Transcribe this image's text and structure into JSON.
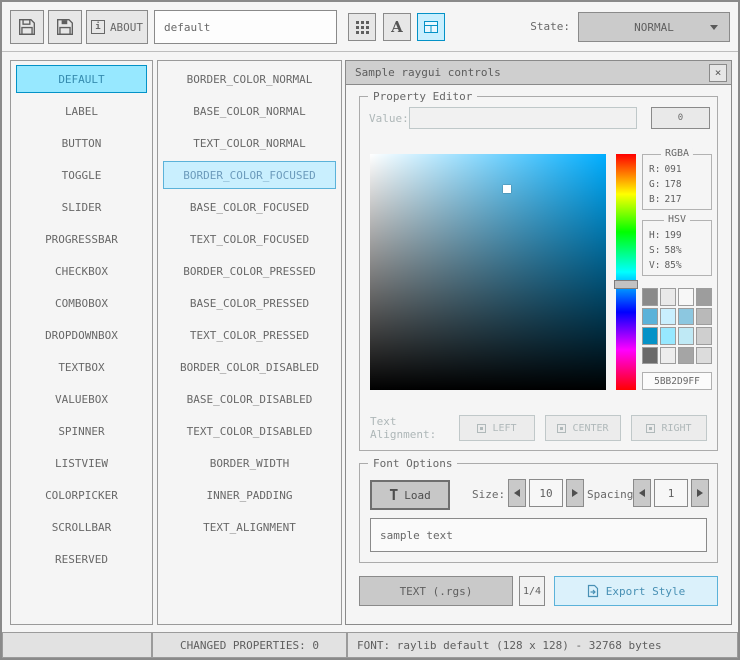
{
  "toolbar": {
    "about_label": "ABOUT",
    "style_name": "default",
    "state_label": "State:",
    "state_value": "NORMAL"
  },
  "icons": {
    "info": "i",
    "letter_a": "A",
    "font_load": "T",
    "close": "×"
  },
  "colors": {
    "accent_focused": "#5bb2d9",
    "accent_pressed": "#0492c7",
    "selected_color": "#5BB2D9"
  },
  "controls_list": {
    "selected_index": 0,
    "items": [
      "DEFAULT",
      "LABEL",
      "BUTTON",
      "TOGGLE",
      "SLIDER",
      "PROGRESSBAR",
      "CHECKBOX",
      "COMBOBOX",
      "DROPDOWNBOX",
      "TEXTBOX",
      "VALUEBOX",
      "SPINNER",
      "LISTVIEW",
      "COLORPICKER",
      "SCROLLBAR",
      "RESERVED"
    ]
  },
  "properties_list": {
    "selected_index": 3,
    "items": [
      "BORDER_COLOR_NORMAL",
      "BASE_COLOR_NORMAL",
      "TEXT_COLOR_NORMAL",
      "BORDER_COLOR_FOCUSED",
      "BASE_COLOR_FOCUSED",
      "TEXT_COLOR_FOCUSED",
      "BORDER_COLOR_PRESSED",
      "BASE_COLOR_PRESSED",
      "TEXT_COLOR_PRESSED",
      "BORDER_COLOR_DISABLED",
      "BASE_COLOR_DISABLED",
      "TEXT_COLOR_DISABLED",
      "BORDER_WIDTH",
      "INNER_PADDING",
      "TEXT_ALIGNMENT"
    ]
  },
  "sample_window": {
    "title": "Sample raygui controls",
    "property_editor": {
      "label": "Property Editor",
      "value_label": "Value:",
      "value_button": "0",
      "rgba": {
        "title": "RGBA",
        "rows": [
          {
            "label": "R:",
            "value": "091"
          },
          {
            "label": "G:",
            "value": "178"
          },
          {
            "label": "B:",
            "value": "217"
          }
        ]
      },
      "hsv": {
        "title": "HSV",
        "rows": [
          {
            "label": "H:",
            "value": "199"
          },
          {
            "label": "S:",
            "value": "58%"
          },
          {
            "label": "V:",
            "value": "85%"
          }
        ]
      },
      "hex": "5BB2D9FF",
      "palette": [
        "#8a8a8a",
        "#e9e9e9",
        "#f7f7f7",
        "#9d9d9d",
        "#5bb2d9",
        "#c9effe",
        "#8cc7e0",
        "#b9b9b9",
        "#0492c7",
        "#97e8ff",
        "#bfe9f5",
        "#cfcfcf",
        "#6a6a6a",
        "#ededed",
        "#a5a5a5",
        "#dcdcdc"
      ],
      "text_alignment_label": "Text Alignment:",
      "align_left": "LEFT",
      "align_center": "CENTER",
      "align_right": "RIGHT"
    },
    "font_options": {
      "label": "Font Options",
      "load_button": "Load",
      "size_label": "Size:",
      "size_value": "10",
      "spacing_label": "Spacing:",
      "spacing_value": "1",
      "sample_text": "sample text"
    },
    "export": {
      "format_button": "TEXT (.rgs)",
      "page_indicator": "1/4",
      "export_button": "Export Style"
    }
  },
  "statusbar": {
    "changed_properties": "CHANGED PROPERTIES: 0",
    "font_info": "FONT: raylib default (128 x 128) - 32768 bytes"
  }
}
